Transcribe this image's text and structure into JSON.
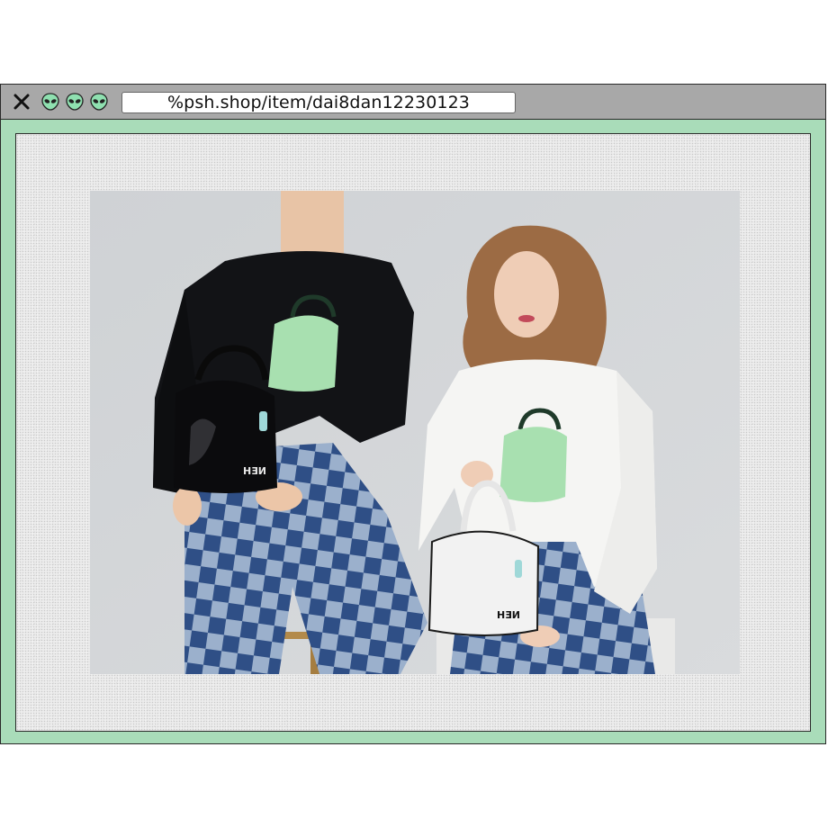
{
  "browser": {
    "url": "%psh.shop/item/dai8dan12230123",
    "close_icon": "close-icon",
    "tab_icons": [
      "alien-icon",
      "alien-icon",
      "alien-icon"
    ]
  },
  "photo": {
    "bag_logo": "HƎИ"
  },
  "colors": {
    "frame_green": "#a9dcb9",
    "titlebar_gray": "#a8a8a8",
    "alien_green": "#8fe0b0"
  }
}
